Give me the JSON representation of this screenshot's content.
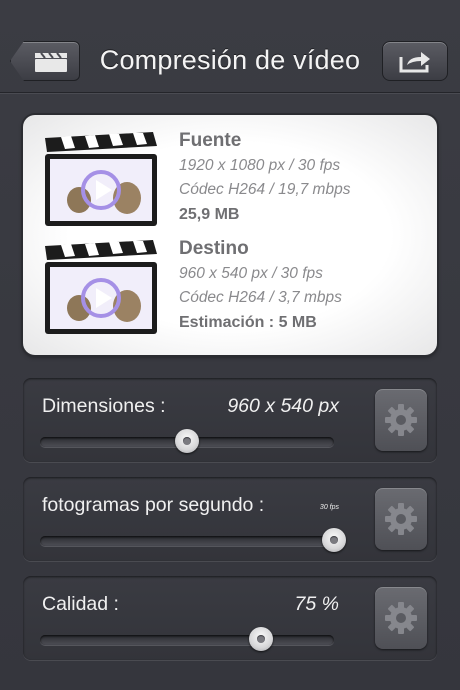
{
  "header": {
    "title": "Compresión de vídeo"
  },
  "source": {
    "heading": "Fuente",
    "resolution": "1920 x 1080 px / 30 fps",
    "codec": "Códec H264 / 19,7 mbps",
    "size": "25,9 MB"
  },
  "destination": {
    "heading": "Destino",
    "resolution": "960 x 540 px / 30 fps",
    "codec": "Códec H264 / 3,7 mbps",
    "estimate": "Estimación : 5 MB"
  },
  "settings": [
    {
      "label": "Dimensiones :",
      "value": "960 x 540 px",
      "slider_fraction": 0.5
    },
    {
      "label": "fotogramas por segundo :",
      "value": "30 fps",
      "slider_fraction": 1.0
    },
    {
      "label": "Calidad :",
      "value": "75 %",
      "slider_fraction": 0.75
    }
  ],
  "icons": {
    "back": "clapperboard-back-icon",
    "share": "share-arrow-icon",
    "gear": "gear-icon",
    "video": "video-clapper-icon"
  }
}
